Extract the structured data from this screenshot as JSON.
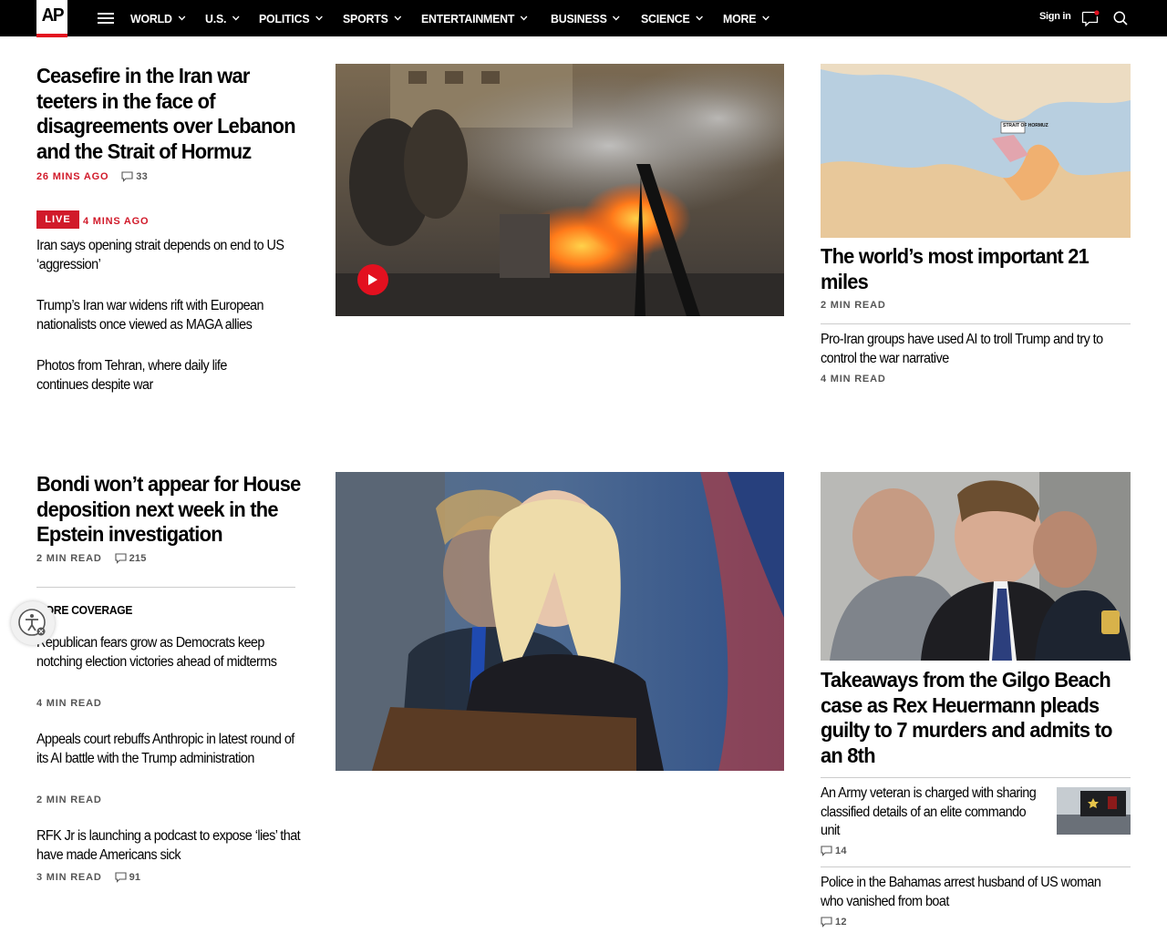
{
  "header": {
    "logo": "AP",
    "nav": [
      "WORLD",
      "U.S.",
      "POLITICS",
      "SPORTS",
      "ENTERTAINMENT",
      "BUSINESS",
      "SCIENCE",
      "MORE"
    ],
    "signin": "Sign in"
  },
  "lead_story": {
    "headline": "Ceasefire in the Iran war teeters in the face of disagreements over Lebanon and the Strait of Hormuz",
    "time": "26 MINS AGO",
    "comments": "33",
    "live_label": "LIVE",
    "live_time": "4 MINS AGO",
    "related": [
      "Iran says opening strait depends on end to US ‘aggression’",
      "Trump’s Iran war widens rift with European nationalists once viewed as MAGA allies",
      "Photos from Tehran, where daily life continues despite war"
    ]
  },
  "right_top": {
    "map_headline": "The world’s most important 21 miles",
    "map_meta": "2 MIN READ",
    "map_labels": [
      "STRAIT OF HORMUZ"
    ],
    "story2": "Pro-Iran groups have used AI to troll Trump and try to control the war narrative",
    "story2_meta": "4 MIN READ"
  },
  "second_story": {
    "headline": "Bondi won’t appear for House deposition next week in the Epstein investigation",
    "meta": "2 MIN READ",
    "comments": "215",
    "more_label": "MORE COVERAGE",
    "items": [
      {
        "title": "Republican fears grow as Democrats keep notching election victories ahead of midterms",
        "meta": "4 MIN READ",
        "comments": ""
      },
      {
        "title": "Appeals court rebuffs Anthropic in latest round of its AI battle with the Trump administration",
        "meta": "2 MIN READ",
        "comments": ""
      },
      {
        "title": "RFK Jr is launching a podcast to expose ‘lies’ that have made Americans sick",
        "meta": "3 MIN READ",
        "comments": "91"
      }
    ]
  },
  "right_bottom": {
    "headline": "Takeaways from the Gilgo Beach case as Rex Heuermann pleads guilty to 7 murders and admits to an 8th",
    "story1": "An Army veteran is charged with sharing classified details of an elite commando unit",
    "story1_comments": "14",
    "story2": "Police in the Bahamas arrest husband of US woman who vanished from boat",
    "story2_comments": "12"
  },
  "colors": {
    "accent_red": "#d11a2a",
    "header_bg": "#000000"
  },
  "icons": [
    "menu-icon",
    "chevron-down-icon",
    "message-icon",
    "search-icon",
    "comment-icon",
    "play-icon",
    "accessibility-icon"
  ]
}
